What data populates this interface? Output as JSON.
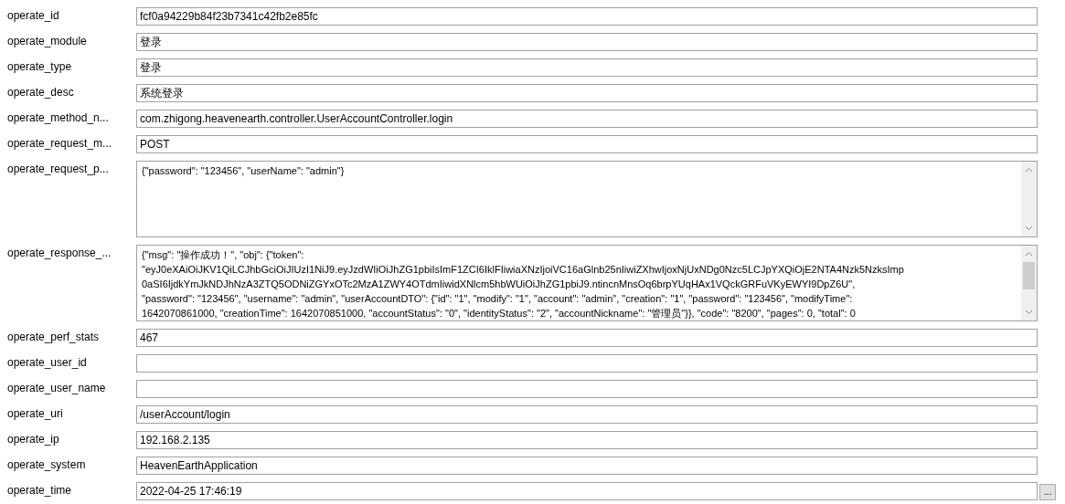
{
  "fields": [
    {
      "kind": "text",
      "label": "operate_id",
      "value": "fcf0a94229b84f23b7341c42fb2e85fc"
    },
    {
      "kind": "text",
      "label": "operate_module",
      "value": "登录"
    },
    {
      "kind": "text",
      "label": "operate_type",
      "value": "登录"
    },
    {
      "kind": "text",
      "label": "operate_desc",
      "value": "系统登录"
    },
    {
      "kind": "text",
      "label": "operate_method_n...",
      "value": "com.zhigong.heavenearth.controller.UserAccountController.login"
    },
    {
      "kind": "text",
      "label": "operate_request_m...",
      "value": "POST"
    },
    {
      "kind": "textarea",
      "label": "operate_request_p...",
      "scrollable": false,
      "lines": [
        "{\"password\": \"123456\", \"userName\": \"admin\"}"
      ]
    },
    {
      "kind": "textarea",
      "label": "operate_response_...",
      "scrollable": true,
      "lines": [
        "{\"msg\": \"操作成功！\", \"obj\": {\"token\":",
        "\"eyJ0eXAiOiJKV1QiLCJhbGciOiJIUzI1NiJ9.eyJzdWIiOiJhZG1pbiIsImF1ZCI6IklFIiwiaXNzIjoiVC16aGlnb25nIiwiZXhwIjoxNjUxNDg0Nzc5LCJpYXQiOjE2NTA4Nzk5NzksImp",
        "0aSI6IjdkYmJkNDJhNzA3ZTQ5ODNiZGYxOTc2MzA1ZWY4OTdmIiwidXNlcm5hbWUiOiJhZG1pbiJ9.ntincnMnsOq6brpYUqHAx1VQckGRFuVKyEWYI9DpZ6U\",",
        "\"password\": \"123456\", \"username\": \"admin\", \"userAccountDTO\": {\"id\": \"1\", \"modify\": \"1\", \"account\": \"admin\", \"creation\": \"1\", \"password\": \"123456\", \"modifyTime\":",
        "1642070861000, \"creationTime\": 1642070851000, \"accountStatus\": \"0\", \"identityStatus\": \"2\", \"accountNickname\": \"管理员\"}}, \"code\": \"8200\", \"pages\": 0, \"total\": 0"
      ]
    },
    {
      "kind": "text",
      "label": "operate_perf_stats",
      "value": "467"
    },
    {
      "kind": "text",
      "label": "operate_user_id"
    },
    {
      "kind": "text",
      "label": "operate_user_name"
    },
    {
      "kind": "text",
      "label": "operate_uri",
      "value": "/userAccount/login"
    },
    {
      "kind": "text",
      "label": "operate_ip",
      "value": "192.168.2.135"
    },
    {
      "kind": "text",
      "label": "operate_system",
      "value": "HeavenEarthApplication"
    },
    {
      "kind": "picker",
      "label": "operate_time",
      "value": "2022-04-25 17:46:19",
      "button": "..."
    }
  ]
}
